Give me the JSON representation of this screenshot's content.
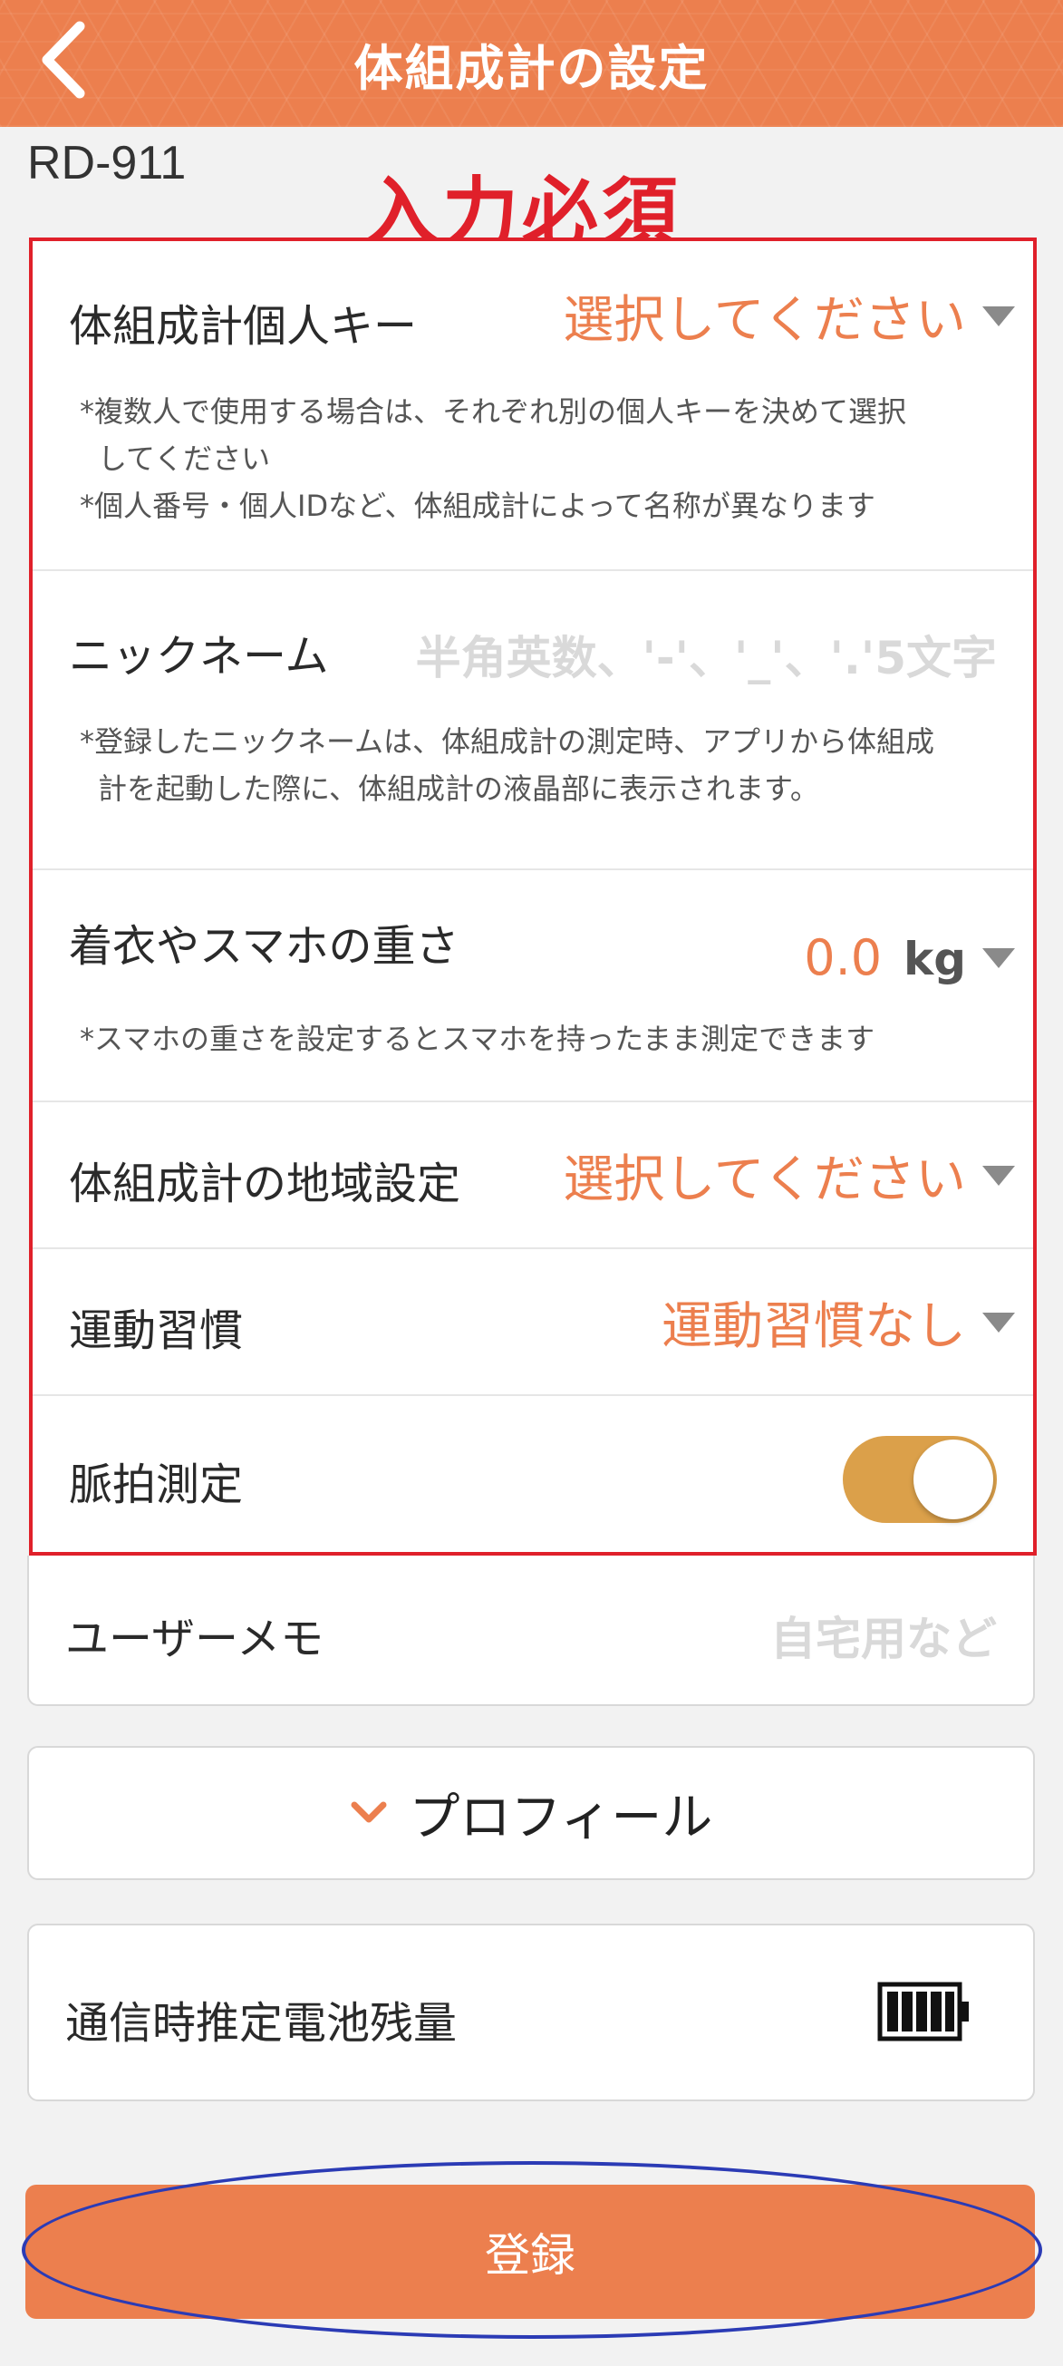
{
  "header": {
    "title": "体組成計の設定"
  },
  "model_name": "RD-911",
  "required_note": "入力必須",
  "personal_key": {
    "label": "体組成計個人キー",
    "value": "選択してください",
    "notes": [
      "*複数人で使用する場合は、それぞれ別の個人キーを決めて選択",
      "してください",
      "*個人番号・個人IDなど、体組成計によって名称が異なります"
    ]
  },
  "nickname": {
    "label": "ニックネーム",
    "placeholder": "半角英数、'-'、'_'、'.'5文字",
    "notes": [
      "*登録したニックネームは、体組成計の測定時、アプリから体組成",
      "計を起動した際に、体組成計の液晶部に表示されます。"
    ]
  },
  "clothing_weight": {
    "label": "着衣やスマホの重さ",
    "value": "0.0",
    "unit": "kg",
    "note": "*スマホの重さを設定するとスマホを持ったまま測定できます"
  },
  "region": {
    "label": "体組成計の地域設定",
    "value": "選択してください"
  },
  "exercise": {
    "label": "運動習慣",
    "value": "運動習慣なし"
  },
  "pulse": {
    "label": "脈拍測定",
    "enabled": true
  },
  "user_memo": {
    "label": "ユーザーメモ",
    "placeholder": "自宅用など"
  },
  "profile": {
    "label": "プロフィール"
  },
  "battery": {
    "label": "通信時推定電池残量",
    "level": 1.0
  },
  "register_button": "登録",
  "colors": {
    "accent": "#ec7f4e",
    "header_bg": "#ec7f4e",
    "required_red": "#e0202a",
    "toggle_on": "#dba04a",
    "annotation_blue": "#2b3bb5"
  },
  "icons": [
    "back-chevron-icon",
    "dropdown-triangle-icon",
    "chevron-down-icon",
    "battery-full-icon"
  ]
}
